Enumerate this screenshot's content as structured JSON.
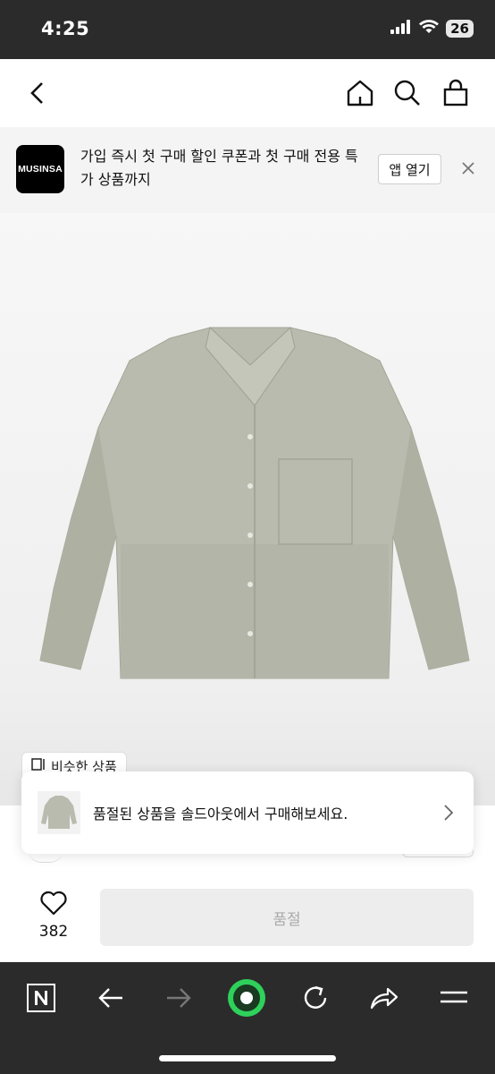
{
  "status": {
    "time": "4:25",
    "battery": "26"
  },
  "nav": {
    "icons": [
      "back-icon",
      "home-icon",
      "search-icon",
      "bag-icon"
    ]
  },
  "promo": {
    "logo_text": "MUSINSA",
    "message": "가입 즉시 첫 구매 할인 쿠폰과 첫 구매 전용 특가 상품까지",
    "app_button": "앱 열기"
  },
  "similar": {
    "label": "비슷한 상품"
  },
  "soldout_card": {
    "text": "품절된 상품을 솔드아웃에서 구매해보세요."
  },
  "action": {
    "like_count": "382",
    "main_button": "품절"
  },
  "browser": {
    "icons": [
      "naver-icon",
      "back-arrow-icon",
      "forward-arrow-icon",
      "green-dot-icon",
      "reload-icon",
      "share-icon",
      "menu-icon"
    ]
  },
  "colors": {
    "accent_green": "#2ed15a",
    "dark_bar": "#2b2b2b",
    "shirt": "#b9bbae"
  }
}
